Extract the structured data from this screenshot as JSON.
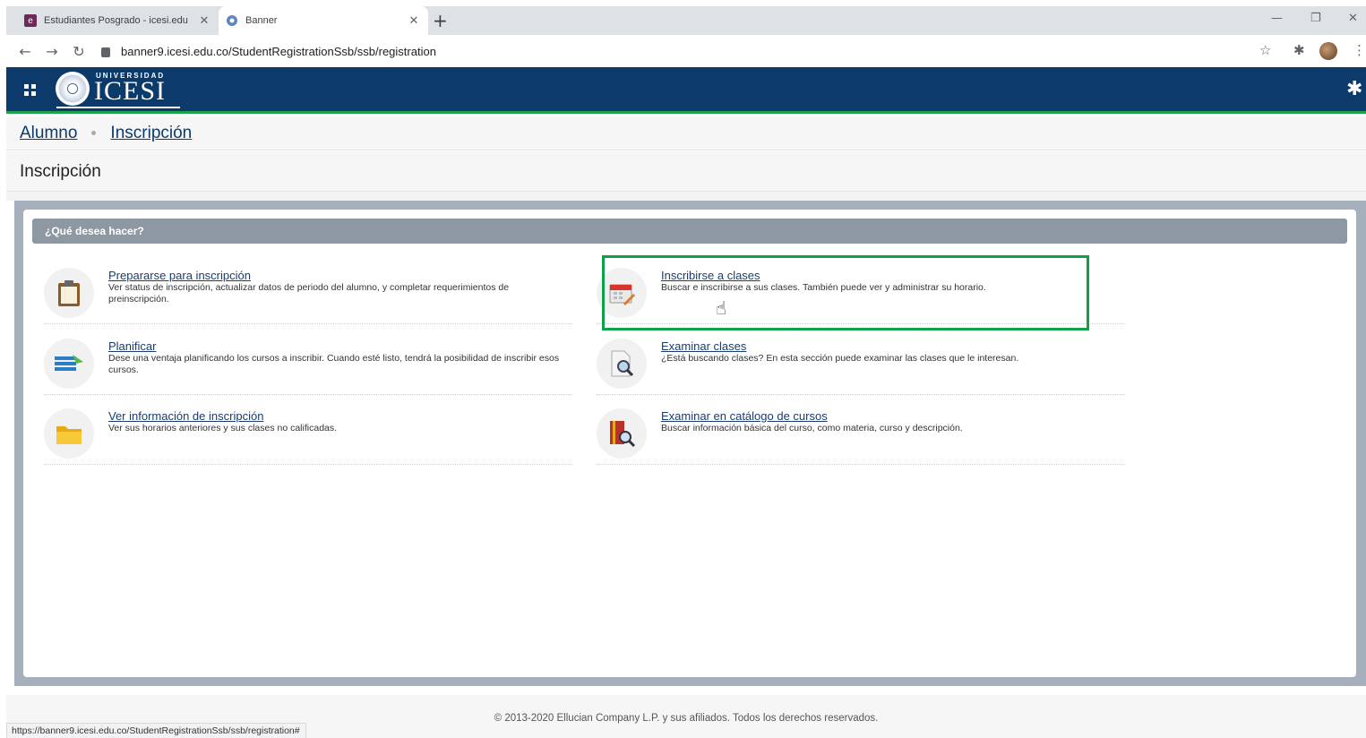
{
  "browser": {
    "tabs": [
      {
        "title": "Estudiantes Posgrado - icesi.edu",
        "favicon": "e"
      },
      {
        "title": "Banner"
      }
    ],
    "new_tab": "+",
    "close": "✕",
    "url": "banner9.icesi.edu.co/StudentRegistrationSsb/ssb/registration",
    "status_url": "https://banner9.icesi.edu.co/StudentRegistrationSsb/ssb/registration#"
  },
  "header": {
    "logo_top": "UNIVERSIDAD",
    "logo_name": "ICESI",
    "color": "#0c3a6b",
    "accent": "#1aa34a"
  },
  "breadcrumb": {
    "items": [
      "Alumno",
      "Inscripción"
    ]
  },
  "page_title": "Inscripción",
  "section": {
    "title": "¿Qué desea hacer?",
    "items": [
      {
        "title": "Preparar­se para inscripción",
        "desc": "Ver status de inscripción, actualizar datos de periodo del alumno, y completar requerimientos de preinscripción.",
        "icon": "clipboard-icon"
      },
      {
        "title": "Inscribirse a clases",
        "desc": "Buscar e inscribirse a sus clases. También puede ver y administrar su horario.",
        "icon": "calendar-pencil-icon"
      },
      {
        "title": "Planificar",
        "desc": "Dese una ventaja planificando los cursos a inscribir. Cuando esté listo, tendrá la posibilidad de inscribir esos cursos.",
        "icon": "plan-list-icon"
      },
      {
        "title": "Examinar clases",
        "desc": "¿Está buscando clases? En esta sección puede examinar las clases que le interesan.",
        "icon": "document-search-icon"
      },
      {
        "title": "Ver información de inscripción",
        "desc": "Ver sus horarios anteriores y sus clases no calificadas.",
        "icon": "folder-icon"
      },
      {
        "title": "Examinar en catálogo de cursos",
        "desc": "Buscar información básica del curso, como materia, curso y descripción.",
        "icon": "book-search-icon"
      }
    ]
  },
  "footer": {
    "copyright": "© 2013-2020 Ellucian Company L.P. y sus afiliados. Todos los derechos reservados."
  }
}
